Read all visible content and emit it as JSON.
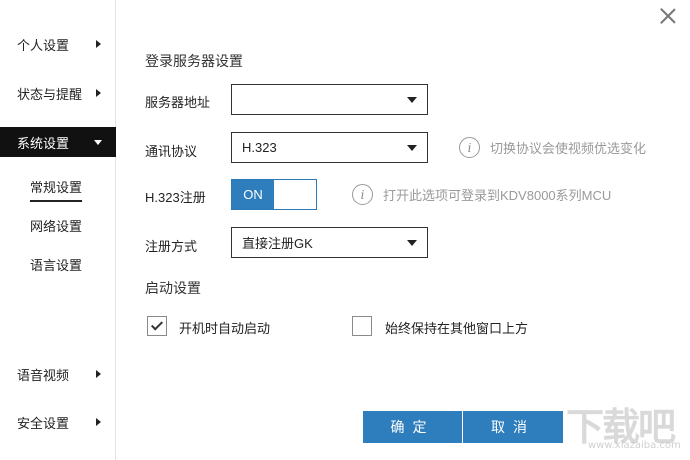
{
  "sidebar": {
    "items": [
      {
        "label": "个人设置"
      },
      {
        "label": "状态与提醒"
      },
      {
        "label": "系统设置"
      },
      {
        "label": "语音视频"
      },
      {
        "label": "安全设置"
      }
    ],
    "subitems": [
      {
        "label": "常规设置"
      },
      {
        "label": "网络设置"
      },
      {
        "label": "语言设置"
      }
    ]
  },
  "main": {
    "section_login": "登录服务器设置",
    "server_address": {
      "label": "服务器地址",
      "value": ""
    },
    "protocol": {
      "label": "通讯协议",
      "value": "H.323",
      "hint": "切换协议会使视频优选变化"
    },
    "h323_register": {
      "label": "H.323注册",
      "toggle": "ON",
      "hint": "打开此选项可登录到KDV8000系列MCU"
    },
    "register_mode": {
      "label": "注册方式",
      "value": "直接注册GK"
    },
    "section_startup": "启动设置",
    "autostart": {
      "label": "开机时自动启动",
      "checked": true
    },
    "always_on_top": {
      "label": "始终保持在其他窗口上方",
      "checked": false
    }
  },
  "buttons": {
    "ok": "确定",
    "cancel": "取消"
  },
  "watermark": {
    "big": "下载吧",
    "small": "www.xiazaiba.com"
  },
  "colors": {
    "accent": "#2e7ebd",
    "active_nav": "#111111",
    "hint": "#9a9a9a"
  }
}
